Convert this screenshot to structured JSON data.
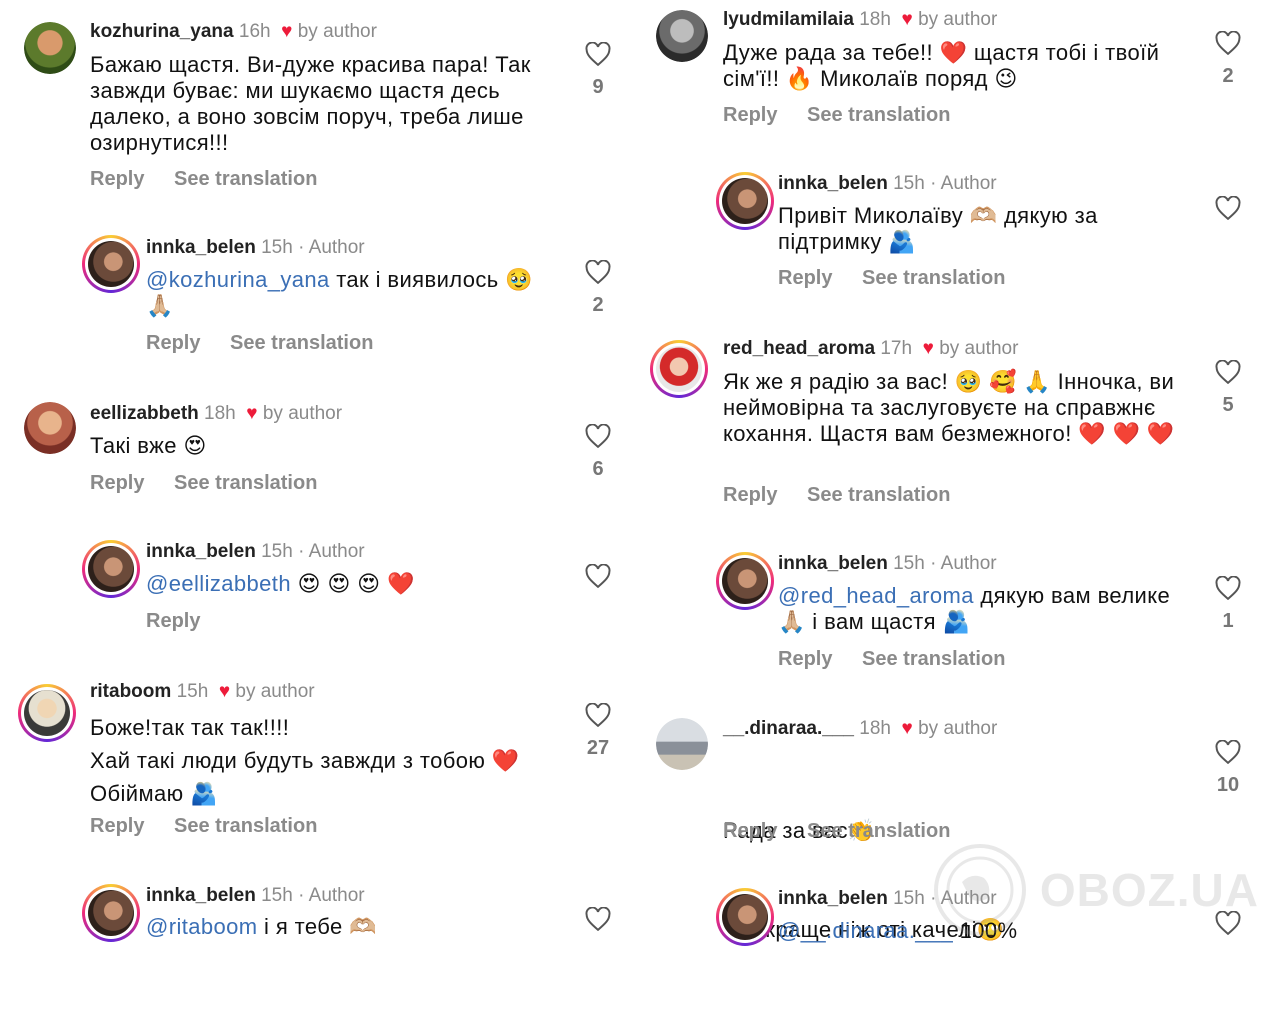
{
  "colors": {
    "heart": "#ed1b3a",
    "mention": "#3b6fb5",
    "meta": "#8a8a8a"
  },
  "labels": {
    "reply": "Reply",
    "see_translation": "See translation",
    "by_author": "by author"
  },
  "left": [
    {
      "user": "kozhurina_yana",
      "time": "16h",
      "tag": "by author",
      "liked_by_author": true,
      "text": "Бажаю щастя. Ви-дуже красива пара! Так завжди буває: ми шукаємо щастя десь далеко, а воно зовсім поруч, треба лише озирнутися!!!",
      "likes": "9",
      "reply": "Reply",
      "translate": "See translation"
    },
    {
      "user": "innka_belen",
      "time": "15h",
      "tag": "· Author",
      "mention": "@kozhurina_yana",
      "text": "так і виявилось 🥹 🙏🏼",
      "likes": "2",
      "reply": "Reply",
      "translate": "See translation"
    },
    {
      "user": "eellizabbeth",
      "time": "18h",
      "tag": "by author",
      "liked_by_author": true,
      "text": "Такі вже 😍",
      "likes": "6",
      "reply": "Reply",
      "translate": "See translation"
    },
    {
      "user": "innka_belen",
      "time": "15h",
      "tag": "· Author",
      "mention": "@eellizabbeth",
      "text": "😍 😍 😍 ❤️",
      "likes": "",
      "reply": "Reply"
    },
    {
      "user": "ritaboom",
      "time": "15h",
      "tag": "by author",
      "liked_by_author": true,
      "lines": [
        "Боже!так так так!!!!",
        "Хай такі люди будуть завжди з тобою ❤️",
        "Обіймаю 🫂"
      ],
      "likes": "27",
      "reply": "Reply",
      "translate": "See translation"
    },
    {
      "user": "innka_belen",
      "time": "15h",
      "tag": "· Author",
      "mention": "@ritaboom",
      "text": "і я тебе 🫶🏼",
      "likes": ""
    }
  ],
  "right": [
    {
      "user": "lyudmilamilaia",
      "time": "18h",
      "tag": "by author",
      "liked_by_author": true,
      "text": "Дуже рада за тебе!! ❤️ щастя тобі і твоїй сім'ї!! 🔥 Миколаїв поряд 😉",
      "likes": "2",
      "reply": "Reply",
      "translate": "See translation"
    },
    {
      "user": "innka_belen",
      "time": "15h",
      "tag": "· Author",
      "text": "Привіт Миколаїву 🫶🏼 дякую за підтримку 🫂",
      "likes": "",
      "reply": "Reply",
      "translate": "See translation"
    },
    {
      "user": "red_head_aroma",
      "time": "17h",
      "tag": "by author",
      "liked_by_author": true,
      "text": "Як же я радію за вас! 🥹 🥰 🙏 Інночка, ви неймовірна та заслуговуєте на справжнє кохання. Щастя вам безмежного! ❤️ ❤️ ❤️",
      "likes": "5",
      "reply": "Reply",
      "translate": "See translation"
    },
    {
      "user": "innka_belen",
      "time": "15h",
      "tag": "· Author",
      "mention": "@red_head_aroma",
      "text": "дякую вам велике 🙏🏼 і вам щастя 🫂",
      "likes": "1",
      "reply": "Reply",
      "translate": "See translation"
    },
    {
      "user": "__.dinaraa.___",
      "time": "18h",
      "tag": "by author",
      "liked_by_author": true,
      "lines": [
        "Рада за вас👏",
        " Це краще ніж оті качелі🙄"
      ],
      "likes": "10",
      "reply": "Reply",
      "translate": "See translation"
    },
    {
      "user": "innka_belen",
      "time": "15h",
      "tag": "· Author",
      "mention": "@__.dinaraa.___",
      "text": "100%",
      "likes": ""
    }
  ],
  "watermark": {
    "text": "OBOZ.UA"
  }
}
